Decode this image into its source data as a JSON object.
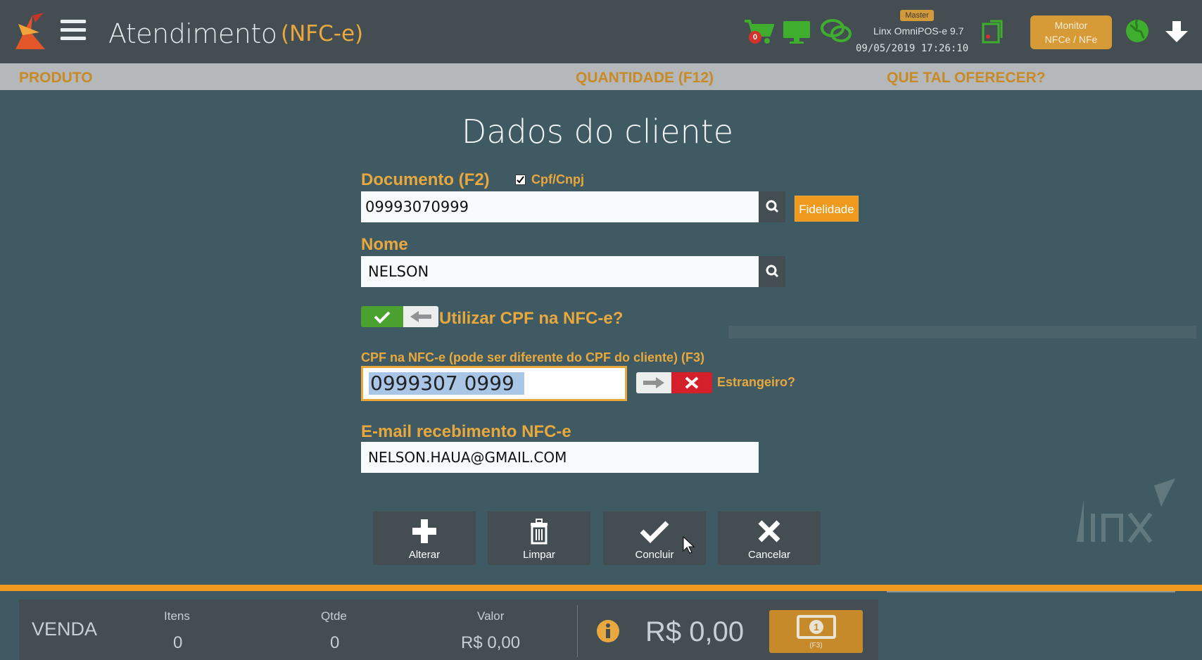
{
  "header": {
    "title": "Atendimento",
    "subtitle": "(NFC-e)",
    "cart_count": "0",
    "user_badge": "Master",
    "system_name": "Linx OmniPOS-e  9.7",
    "datetime": "09/05/2019 17:26:10",
    "monitor_line1": "Monitor",
    "monitor_line2": "NFCe / NFe"
  },
  "columns": {
    "produto": "PRODUTO",
    "quantidade": "QUANTIDADE (F12)",
    "oferecer": "QUE TAL OFERECER?"
  },
  "dialog": {
    "title": "Dados do cliente",
    "documento_label": "Documento (F2)",
    "cpf_cnpj_label": "Cpf/Cnpj",
    "documento_value": "09993070999",
    "fidelidade_label": "Fidelidade",
    "nome_label": "Nome",
    "nome_value": "NELSON",
    "utilizar_cpf_label": "Utilizar CPF na NFC-e?",
    "utilizar_cpf_on": true,
    "cpf_nfce_label": "CPF na NFC-e (pode ser diferente do CPF do cliente) (F3)",
    "cpf_nfce_value": "0999307 0999",
    "estrangeiro_label": "Estrangeiro?",
    "estrangeiro_on": false,
    "email_label": "E-mail recebimento NFC-e",
    "email_value": "NELSON.HAUA@GMAIL.COM",
    "buttons": {
      "alterar": "Alterar",
      "limpar": "Limpar",
      "concluir": "Concluir",
      "cancelar": "Cancelar"
    }
  },
  "summary": {
    "venda_label": "VENDA",
    "itens_label": "Itens",
    "itens_value": "0",
    "qtde_label": "Qtde",
    "qtde_value": "0",
    "valor_label": "Valor",
    "valor_value": "R$ 0,00",
    "total": "R$ 0,00",
    "pay_shortcut": "(F3)"
  },
  "colors": {
    "accent": "#e8a83d",
    "topbar": "#434d52",
    "background": "#3f5a63",
    "toggle_on": "#4aa12f",
    "toggle_off": "#d4202b"
  }
}
